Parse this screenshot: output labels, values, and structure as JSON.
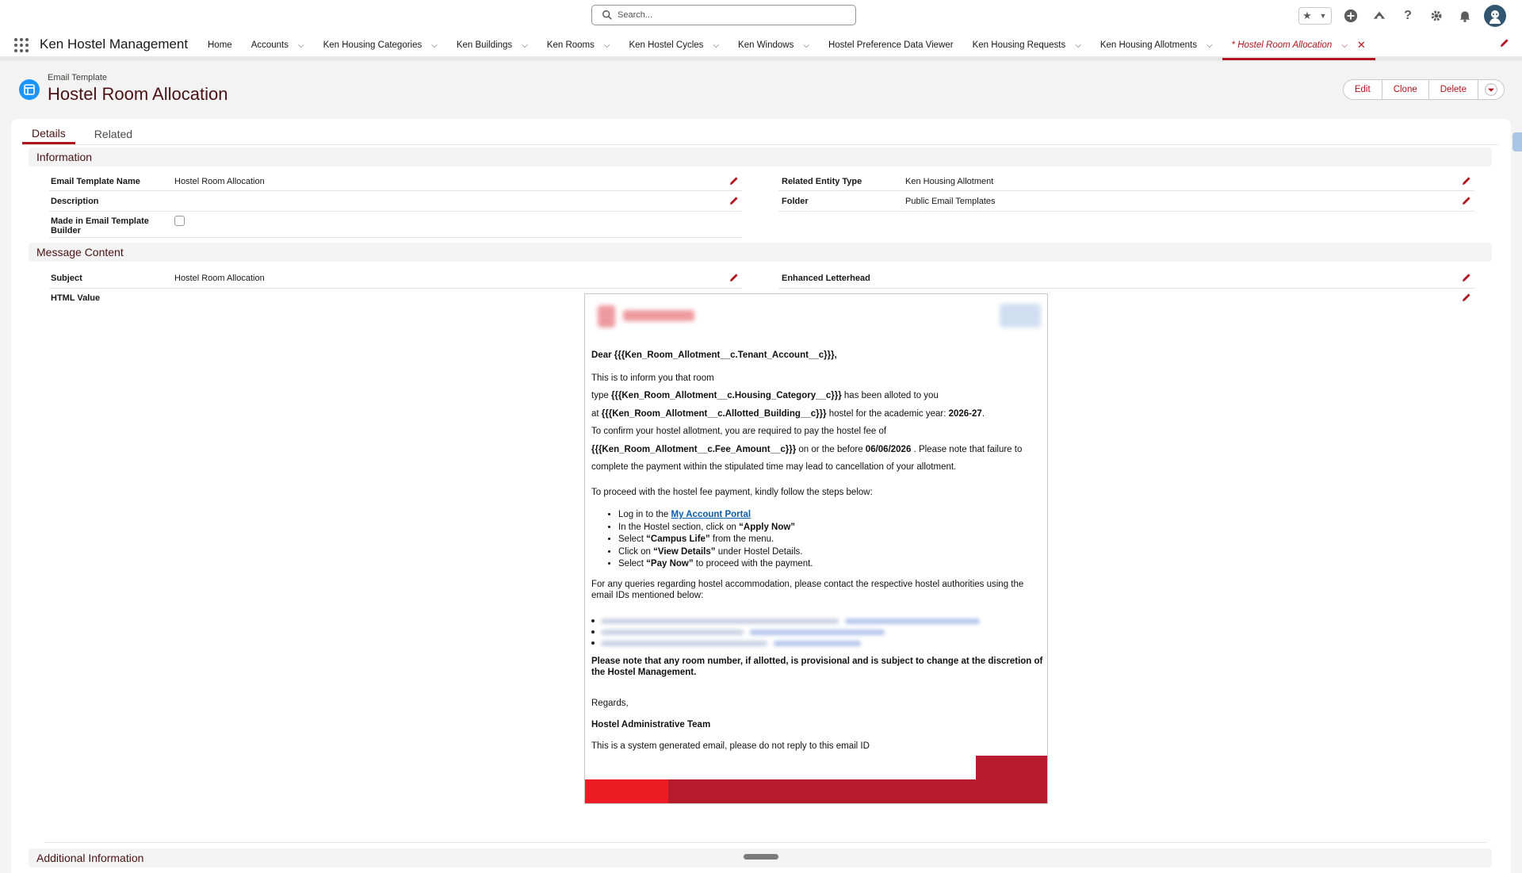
{
  "search": {
    "placeholder": "Search..."
  },
  "app": {
    "name": "Ken Hostel Management"
  },
  "nav": {
    "items": [
      {
        "label": "Home",
        "has_menu": false
      },
      {
        "label": "Accounts",
        "has_menu": true
      },
      {
        "label": "Ken Housing Categories",
        "has_menu": true
      },
      {
        "label": "Ken Buildings",
        "has_menu": true
      },
      {
        "label": "Ken Rooms",
        "has_menu": true
      },
      {
        "label": "Ken Hostel Cycles",
        "has_menu": true
      },
      {
        "label": "Ken Windows",
        "has_menu": true
      },
      {
        "label": "Hostel Preference Data Viewer",
        "has_menu": false
      },
      {
        "label": "Ken Housing Requests",
        "has_menu": true
      },
      {
        "label": "Ken Housing Allotments",
        "has_menu": true
      }
    ],
    "active_tab": "* Hostel Room Allocation"
  },
  "record": {
    "type": "Email Template",
    "title": "Hostel Room Allocation",
    "actions": {
      "edit": "Edit",
      "clone": "Clone",
      "delete": "Delete"
    }
  },
  "tabs": {
    "details": "Details",
    "related": "Related"
  },
  "information": {
    "heading": "Information",
    "template_name_label": "Email Template Name",
    "template_name_value": "Hostel Room Allocation",
    "description_label": "Description",
    "made_in_builder_label": "Made in Email Template Builder",
    "related_entity_label": "Related Entity Type",
    "related_entity_value": "Ken Housing Allotment",
    "folder_label": "Folder",
    "folder_value": "Public Email Templates"
  },
  "message": {
    "heading": "Message Content",
    "subject_label": "Subject",
    "subject_value": "Hostel Room Allocation",
    "letterhead_label": "Enhanced Letterhead",
    "html_label": "HTML Value"
  },
  "email": {
    "greeting": "Dear {{{Ken_Room_Allotment__c.Tenant_Account__c}}},",
    "line1": "This is to inform you that room",
    "line2_pre": "type ",
    "line2_bold": "{{{Ken_Room_Allotment__c.Housing_Category__c}}}",
    "line2_post": " has been alloted to you",
    "line3_pre": "at ",
    "line3_bold": "{{{Ken_Room_Allotment__c.Allotted_Building__c}}}",
    "line3_mid": " hostel for the academic year: ",
    "line3_year": "2026-27",
    "line3_end": ".",
    "line4": "To confirm your hostel allotment, you are required to pay the hostel fee of",
    "line5_bold": "{{{Ken_Room_Allotment__c.Fee_Amount__c}}}",
    "line5_mid": " on or the before ",
    "line5_date": "06/06/2026",
    "line5_post": " . Please note that failure to",
    "line6": "complete the payment within the stipulated time may lead to cancellation of your allotment.",
    "steps_intro": "To proceed with the hostel fee payment, kindly follow the steps below:",
    "step1_pre": "Log in to the ",
    "step1_link": "My Account Portal",
    "step2_pre": "In the Hostel section, click on ",
    "step2_bold": "“Apply Now”",
    "step3_pre": "Select ",
    "step3_bold": "“Campus Life”",
    "step3_post": " from the menu.",
    "step4_pre": "Click on ",
    "step4_bold": "“View Details”",
    "step4_post": " under Hostel Details.",
    "step5_pre": "Select ",
    "step5_bold": "“Pay Now”",
    "step5_post": " to proceed with the payment.",
    "queries": "For any queries regarding hostel accommodation, please contact the respective hostel authorities using the email IDs mentioned below:",
    "note": "Please note that any room number, if allotted, is provisional and is subject to change at the discretion of the Hostel Management.",
    "regards": "Regards,",
    "team": "Hostel Administrative Team",
    "system_note": "This is a system generated email, please do not reply to this email ID"
  },
  "additional": {
    "heading": "Additional Information"
  },
  "colors": {
    "brand": "#b0141e",
    "footer_dark": "#b71c2e",
    "footer_red": "#ee1c25",
    "icon_blue": "#1b96ff"
  }
}
